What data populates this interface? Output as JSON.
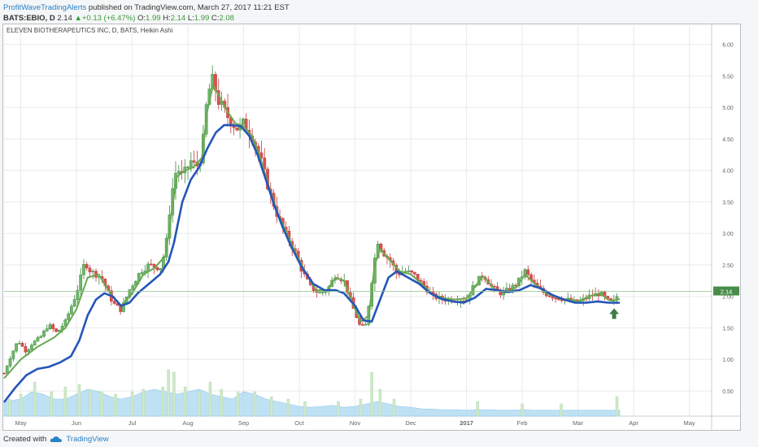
{
  "header": {
    "line1": {
      "author": "ProfitWaveTradingAlerts",
      "rest": " published on TradingView.com, March 27, 2017 11:21 EST"
    },
    "line2": {
      "symbol": "BATS:EBIO, D",
      "price": "2.14",
      "change_arrow": "▲",
      "change": "+0.13 (+6.47%)",
      "o_label": "O:",
      "o_val": "1.99",
      "h_label": "H:",
      "h_val": "2.14",
      "l_label": "L:",
      "l_val": "1.99",
      "c_label": "C:",
      "c_val": "2.08"
    }
  },
  "footer": {
    "created": "Created with",
    "brand": "TradingView",
    "logo_icon": "tradingview-cloud-icon"
  },
  "colors": {
    "up": "#3d8a3d",
    "up_fill": "#6fb86f",
    "down": "#c23b3b",
    "down_fill": "#d9534f",
    "ma_fast": "#6aa84f",
    "ma_slow": "#2456b8",
    "volume": "#a9d7f0",
    "volume_bar": "#cfe8c9",
    "grid": "#e8eaed",
    "price_label_bg": "#4a8c4a",
    "arrow": "#3d7a4a"
  },
  "chart_data": {
    "type": "candlestick",
    "title": "ELEVEN BIOTHERAPEUTICS INC, D, BATS, Heikin Ashi",
    "x_labels": [
      "May",
      "Jun",
      "Jul",
      "Aug",
      "Sep",
      "Oct",
      "Nov",
      "Dec",
      "2017",
      "Feb",
      "Mar",
      "Apr",
      "May"
    ],
    "x_label_pos": [
      0.3,
      1.3,
      2.3,
      3.3,
      4.3,
      5.3,
      6.3,
      7.3,
      8.3,
      9.3,
      10.3,
      11.3,
      12.3
    ],
    "y_ticks": [
      "6.00",
      "5.50",
      "5.00",
      "4.50",
      "4.00",
      "3.50",
      "3.00",
      "2.50",
      "2.00",
      "1.50",
      "1.00",
      "0.50"
    ],
    "y_tick_values": [
      6.0,
      5.5,
      5.0,
      4.5,
      4.0,
      3.5,
      3.0,
      2.5,
      2.0,
      1.5,
      1.0,
      0.5
    ],
    "ylim": [
      0.1,
      6.15
    ],
    "xlim": [
      0,
      12.7
    ],
    "last_price_label": "2.14",
    "last_price": 2.08,
    "price_path": [
      [
        0.0,
        0.78
      ],
      [
        0.12,
        1.05
      ],
      [
        0.25,
        1.3
      ],
      [
        0.4,
        1.12
      ],
      [
        0.5,
        1.25
      ],
      [
        0.65,
        1.35
      ],
      [
        0.8,
        1.55
      ],
      [
        0.95,
        1.42
      ],
      [
        1.1,
        1.6
      ],
      [
        1.3,
        2.05
      ],
      [
        1.45,
        2.55
      ],
      [
        1.55,
        2.4
      ],
      [
        1.75,
        2.3
      ],
      [
        1.95,
        1.9
      ],
      [
        2.1,
        1.78
      ],
      [
        2.25,
        2.1
      ],
      [
        2.45,
        2.4
      ],
      [
        2.6,
        2.5
      ],
      [
        2.8,
        2.45
      ],
      [
        2.9,
        2.75
      ],
      [
        3.0,
        3.6
      ],
      [
        3.1,
        4.05
      ],
      [
        3.2,
        3.9
      ],
      [
        3.35,
        4.15
      ],
      [
        3.45,
        4.05
      ],
      [
        3.55,
        4.25
      ],
      [
        3.65,
        5.2
      ],
      [
        3.75,
        5.45
      ],
      [
        3.85,
        5.1
      ],
      [
        3.95,
        4.95
      ],
      [
        4.05,
        4.8
      ],
      [
        4.2,
        4.65
      ],
      [
        4.3,
        4.75
      ],
      [
        4.45,
        4.55
      ],
      [
        4.6,
        4.2
      ],
      [
        4.75,
        3.7
      ],
      [
        4.9,
        3.3
      ],
      [
        5.05,
        3.0
      ],
      [
        5.2,
        2.75
      ],
      [
        5.35,
        2.4
      ],
      [
        5.5,
        2.15
      ],
      [
        5.65,
        2.05
      ],
      [
        5.8,
        2.1
      ],
      [
        5.95,
        2.35
      ],
      [
        6.1,
        2.25
      ],
      [
        6.25,
        1.85
      ],
      [
        6.4,
        1.5
      ],
      [
        6.5,
        1.55
      ],
      [
        6.6,
        2.25
      ],
      [
        6.7,
        2.9
      ],
      [
        6.8,
        2.7
      ],
      [
        6.95,
        2.55
      ],
      [
        7.05,
        2.35
      ],
      [
        7.2,
        2.4
      ],
      [
        7.35,
        2.35
      ],
      [
        7.5,
        2.2
      ],
      [
        7.7,
        2.0
      ],
      [
        7.9,
        1.95
      ],
      [
        8.1,
        1.95
      ],
      [
        8.3,
        1.95
      ],
      [
        8.45,
        2.2
      ],
      [
        8.6,
        2.35
      ],
      [
        8.75,
        2.15
      ],
      [
        8.9,
        2.05
      ],
      [
        9.05,
        2.1
      ],
      [
        9.2,
        2.2
      ],
      [
        9.35,
        2.4
      ],
      [
        9.5,
        2.2
      ],
      [
        9.7,
        2.05
      ],
      [
        9.9,
        1.98
      ],
      [
        10.1,
        1.95
      ],
      [
        10.3,
        1.9
      ],
      [
        10.5,
        2.0
      ],
      [
        10.7,
        2.05
      ],
      [
        10.85,
        1.92
      ],
      [
        10.95,
        1.92
      ],
      [
        11.05,
        2.08
      ]
    ],
    "ma_fast": [
      [
        0.0,
        0.7
      ],
      [
        0.3,
        1.0
      ],
      [
        0.6,
        1.2
      ],
      [
        0.9,
        1.35
      ],
      [
        1.1,
        1.5
      ],
      [
        1.3,
        1.8
      ],
      [
        1.5,
        2.3
      ],
      [
        1.7,
        2.35
      ],
      [
        1.9,
        2.05
      ],
      [
        2.1,
        1.85
      ],
      [
        2.3,
        2.05
      ],
      [
        2.5,
        2.35
      ],
      [
        2.7,
        2.45
      ],
      [
        2.9,
        2.65
      ],
      [
        3.0,
        3.3
      ],
      [
        3.1,
        3.9
      ],
      [
        3.25,
        4.0
      ],
      [
        3.4,
        4.05
      ],
      [
        3.55,
        4.2
      ],
      [
        3.65,
        4.95
      ],
      [
        3.75,
        5.35
      ],
      [
        3.85,
        5.2
      ],
      [
        4.0,
        4.95
      ],
      [
        4.15,
        4.75
      ],
      [
        4.3,
        4.7
      ],
      [
        4.45,
        4.55
      ],
      [
        4.6,
        4.2
      ],
      [
        4.75,
        3.75
      ],
      [
        4.9,
        3.35
      ],
      [
        5.05,
        3.05
      ],
      [
        5.2,
        2.75
      ],
      [
        5.4,
        2.4
      ],
      [
        5.6,
        2.1
      ],
      [
        5.8,
        2.1
      ],
      [
        5.95,
        2.3
      ],
      [
        6.1,
        2.25
      ],
      [
        6.25,
        1.9
      ],
      [
        6.4,
        1.6
      ],
      [
        6.55,
        1.7
      ],
      [
        6.65,
        2.5
      ],
      [
        6.75,
        2.75
      ],
      [
        6.9,
        2.6
      ],
      [
        7.1,
        2.4
      ],
      [
        7.3,
        2.35
      ],
      [
        7.5,
        2.2
      ],
      [
        7.7,
        2.02
      ],
      [
        7.9,
        1.97
      ],
      [
        8.1,
        1.95
      ],
      [
        8.3,
        1.97
      ],
      [
        8.45,
        2.15
      ],
      [
        8.6,
        2.32
      ],
      [
        8.8,
        2.12
      ],
      [
        9.0,
        2.06
      ],
      [
        9.2,
        2.15
      ],
      [
        9.35,
        2.35
      ],
      [
        9.5,
        2.22
      ],
      [
        9.7,
        2.07
      ],
      [
        9.9,
        1.99
      ],
      [
        10.1,
        1.95
      ],
      [
        10.3,
        1.92
      ],
      [
        10.5,
        2.0
      ],
      [
        10.7,
        2.05
      ],
      [
        10.85,
        1.94
      ],
      [
        10.95,
        1.93
      ],
      [
        11.05,
        1.96
      ]
    ],
    "ma_slow": [
      [
        0.0,
        0.32
      ],
      [
        0.2,
        0.55
      ],
      [
        0.4,
        0.75
      ],
      [
        0.6,
        0.85
      ],
      [
        0.8,
        0.88
      ],
      [
        1.0,
        0.95
      ],
      [
        1.2,
        1.05
      ],
      [
        1.35,
        1.3
      ],
      [
        1.5,
        1.7
      ],
      [
        1.65,
        1.95
      ],
      [
        1.8,
        2.05
      ],
      [
        1.95,
        2.0
      ],
      [
        2.1,
        1.85
      ],
      [
        2.25,
        1.9
      ],
      [
        2.4,
        2.05
      ],
      [
        2.6,
        2.2
      ],
      [
        2.8,
        2.35
      ],
      [
        2.95,
        2.55
      ],
      [
        3.05,
        2.85
      ],
      [
        3.2,
        3.5
      ],
      [
        3.35,
        3.85
      ],
      [
        3.5,
        4.05
      ],
      [
        3.65,
        4.35
      ],
      [
        3.8,
        4.6
      ],
      [
        3.95,
        4.72
      ],
      [
        4.1,
        4.72
      ],
      [
        4.25,
        4.7
      ],
      [
        4.4,
        4.55
      ],
      [
        4.55,
        4.25
      ],
      [
        4.7,
        3.85
      ],
      [
        4.85,
        3.45
      ],
      [
        5.0,
        3.1
      ],
      [
        5.15,
        2.8
      ],
      [
        5.35,
        2.45
      ],
      [
        5.55,
        2.2
      ],
      [
        5.75,
        2.1
      ],
      [
        5.95,
        2.1
      ],
      [
        6.1,
        2.05
      ],
      [
        6.3,
        1.85
      ],
      [
        6.45,
        1.62
      ],
      [
        6.6,
        1.6
      ],
      [
        6.75,
        1.95
      ],
      [
        6.9,
        2.3
      ],
      [
        7.05,
        2.4
      ],
      [
        7.25,
        2.3
      ],
      [
        7.45,
        2.2
      ],
      [
        7.65,
        2.05
      ],
      [
        7.85,
        1.96
      ],
      [
        8.05,
        1.92
      ],
      [
        8.25,
        1.9
      ],
      [
        8.45,
        1.98
      ],
      [
        8.65,
        2.12
      ],
      [
        8.85,
        2.1
      ],
      [
        9.05,
        2.07
      ],
      [
        9.25,
        2.1
      ],
      [
        9.45,
        2.18
      ],
      [
        9.65,
        2.12
      ],
      [
        9.85,
        2.02
      ],
      [
        10.05,
        1.95
      ],
      [
        10.25,
        1.9
      ],
      [
        10.45,
        1.9
      ],
      [
        10.65,
        1.92
      ],
      [
        10.85,
        1.9
      ],
      [
        11.05,
        1.9
      ]
    ],
    "volume_area": [
      [
        0.0,
        0.3
      ],
      [
        0.3,
        0.35
      ],
      [
        0.5,
        0.5
      ],
      [
        0.7,
        0.45
      ],
      [
        0.9,
        0.35
      ],
      [
        1.1,
        0.35
      ],
      [
        1.3,
        0.45
      ],
      [
        1.5,
        0.55
      ],
      [
        1.7,
        0.5
      ],
      [
        1.9,
        0.4
      ],
      [
        2.1,
        0.35
      ],
      [
        2.3,
        0.4
      ],
      [
        2.5,
        0.5
      ],
      [
        2.7,
        0.55
      ],
      [
        2.9,
        0.5
      ],
      [
        3.1,
        0.45
      ],
      [
        3.3,
        0.5
      ],
      [
        3.5,
        0.55
      ],
      [
        3.7,
        0.45
      ],
      [
        3.9,
        0.4
      ],
      [
        4.1,
        0.35
      ],
      [
        4.3,
        0.5
      ],
      [
        4.5,
        0.45
      ],
      [
        4.7,
        0.35
      ],
      [
        4.9,
        0.3
      ],
      [
        5.1,
        0.25
      ],
      [
        5.3,
        0.2
      ],
      [
        5.5,
        0.18
      ],
      [
        5.7,
        0.2
      ],
      [
        5.9,
        0.22
      ],
      [
        6.1,
        0.18
      ],
      [
        6.3,
        0.2
      ],
      [
        6.5,
        0.25
      ],
      [
        6.7,
        0.3
      ],
      [
        6.9,
        0.25
      ],
      [
        7.1,
        0.2
      ],
      [
        7.3,
        0.18
      ],
      [
        7.5,
        0.15
      ],
      [
        7.7,
        0.14
      ],
      [
        7.9,
        0.13
      ],
      [
        8.1,
        0.13
      ],
      [
        8.3,
        0.12
      ],
      [
        8.5,
        0.13
      ],
      [
        8.7,
        0.13
      ],
      [
        8.9,
        0.12
      ],
      [
        9.1,
        0.12
      ],
      [
        9.3,
        0.13
      ],
      [
        9.5,
        0.12
      ],
      [
        9.7,
        0.12
      ],
      [
        9.9,
        0.12
      ],
      [
        10.1,
        0.12
      ],
      [
        10.3,
        0.12
      ],
      [
        10.5,
        0.12
      ],
      [
        10.7,
        0.12
      ],
      [
        11.05,
        0.12
      ]
    ],
    "volume_spikes": [
      [
        0.1,
        0.35
      ],
      [
        0.3,
        0.45
      ],
      [
        0.55,
        0.7
      ],
      [
        0.85,
        0.5
      ],
      [
        1.1,
        0.6
      ],
      [
        1.35,
        0.65
      ],
      [
        1.55,
        0.55
      ],
      [
        1.75,
        0.5
      ],
      [
        2.0,
        0.45
      ],
      [
        2.3,
        0.5
      ],
      [
        2.5,
        0.55
      ],
      [
        2.85,
        0.6
      ],
      [
        2.95,
        0.95
      ],
      [
        3.05,
        0.9
      ],
      [
        3.25,
        0.6
      ],
      [
        3.5,
        0.5
      ],
      [
        3.7,
        0.7
      ],
      [
        3.9,
        0.55
      ],
      [
        4.2,
        0.5
      ],
      [
        4.5,
        0.5
      ],
      [
        4.8,
        0.4
      ],
      [
        5.1,
        0.35
      ],
      [
        5.4,
        0.3
      ],
      [
        6.0,
        0.3
      ],
      [
        6.4,
        0.35
      ],
      [
        6.6,
        0.9
      ],
      [
        6.75,
        0.55
      ],
      [
        7.0,
        0.35
      ],
      [
        8.5,
        0.3
      ],
      [
        9.3,
        0.25
      ],
      [
        10.0,
        0.25
      ],
      [
        11.0,
        0.4
      ]
    ],
    "arrow_at": [
      10.95,
      1.72
    ],
    "arrow_icon": "up-arrow-icon"
  }
}
